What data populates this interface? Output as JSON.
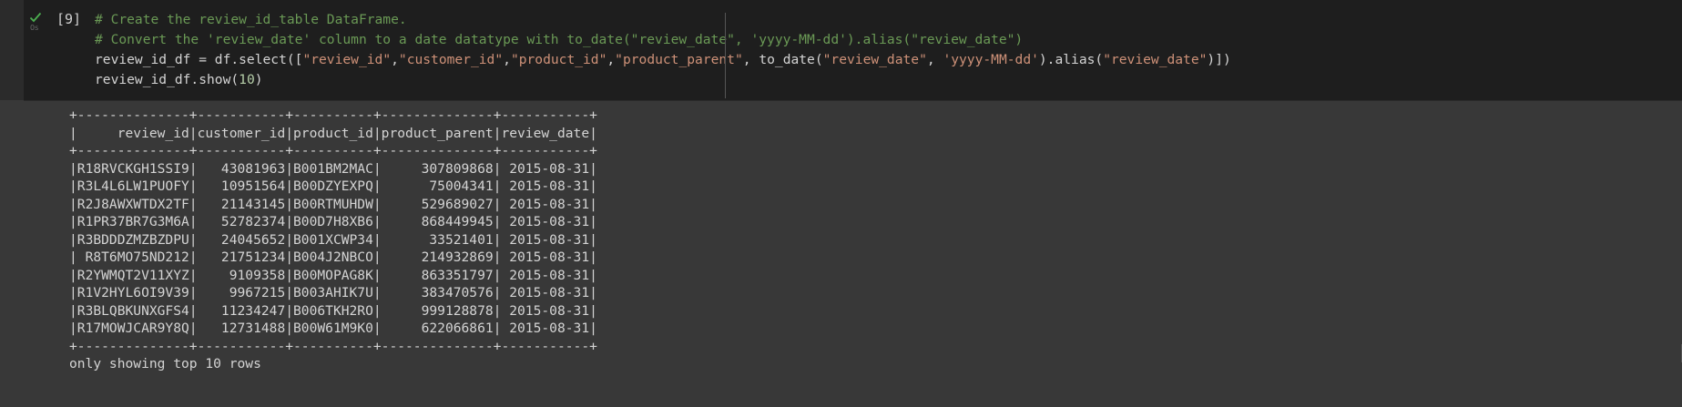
{
  "cell": {
    "execution_count": "[9]",
    "status_icon": "check-icon",
    "duration": "0s",
    "code_lines": [
      [
        {
          "t": "# Create the review_id_table DataFrame.",
          "c": "comment"
        }
      ],
      [
        {
          "t": "# Convert the 'review_date' column to a date datatype with to_date(\"review_date\", 'yyyy-MM-dd').alias(\"review_date\")",
          "c": "comment"
        }
      ],
      [
        {
          "t": "review_id_df = df.select([",
          "c": "plain"
        },
        {
          "t": "\"review_id\"",
          "c": "str"
        },
        {
          "t": ",",
          "c": "plain"
        },
        {
          "t": "\"customer_id\"",
          "c": "str"
        },
        {
          "t": ",",
          "c": "plain"
        },
        {
          "t": "\"product_id\"",
          "c": "str"
        },
        {
          "t": ",",
          "c": "plain"
        },
        {
          "t": "\"product_parent\"",
          "c": "str"
        },
        {
          "t": ", to_date(",
          "c": "plain"
        },
        {
          "t": "\"review_date\"",
          "c": "str"
        },
        {
          "t": ", ",
          "c": "plain"
        },
        {
          "t": "'yyyy-MM-dd'",
          "c": "str"
        },
        {
          "t": ").alias(",
          "c": "plain"
        },
        {
          "t": "\"review_date\"",
          "c": "str"
        },
        {
          "t": ")])",
          "c": "plain"
        }
      ],
      [
        {
          "t": "review_id_df.show(",
          "c": "plain"
        },
        {
          "t": "10",
          "c": "num"
        },
        {
          "t": ")",
          "c": "plain"
        }
      ]
    ]
  },
  "output": {
    "lines": [
      "+--------------+-----------+----------+--------------+-----------+",
      "|     review_id|customer_id|product_id|product_parent|review_date|",
      "+--------------+-----------+----------+--------------+-----------+",
      "|R18RVCKGH1SSI9|   43081963|B001BM2MAC|     307809868| 2015-08-31|",
      "|R3L4L6LW1PUOFY|   10951564|B00DZYEXPQ|      75004341| 2015-08-31|",
      "|R2J8AWXWTDX2TF|   21143145|B00RTMUHDW|     529689027| 2015-08-31|",
      "|R1PR37BR7G3M6A|   52782374|B00D7H8XB6|     868449945| 2015-08-31|",
      "|R3BDDDZMZBZDPU|   24045652|B001XCWP34|      33521401| 2015-08-31|",
      "| R8T6MO75ND212|   21751234|B004J2NBCO|     214932869| 2015-08-31|",
      "|R2YWMQT2V11XYZ|    9109358|B00MOPAG8K|     863351797| 2015-08-31|",
      "|R1V2HYL6OI9V39|    9967215|B003AHIK7U|     383470576| 2015-08-31|",
      "|R3BLQBKUNXGFS4|   11234247|B006TKH2RO|     999128878| 2015-08-31|",
      "|R17MOWJCAR9Y8Q|   12731488|B00W61M9K0|     622066861| 2015-08-31|",
      "+--------------+-----------+----------+--------------+-----------+"
    ],
    "footer": "only showing top 10 rows"
  },
  "colors": {
    "comment": "#6a9955",
    "string": "#ce9178",
    "number": "#b5cea8",
    "check": "#4caf50"
  }
}
